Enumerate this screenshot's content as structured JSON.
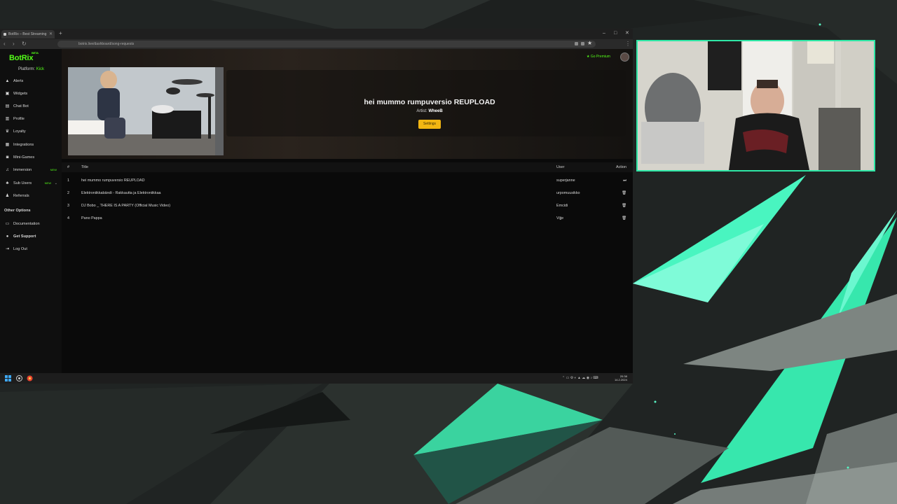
{
  "browser": {
    "tab_title": "BotRix – Best Streaming",
    "new_tab": "+",
    "url": "botrix.live/dashboard/song-requests",
    "minimize": "–",
    "maximize": "□",
    "close": "✕"
  },
  "app": {
    "logo": "BotRix",
    "logo_badge": "BETA",
    "platform_label": "Platform:",
    "platform_value": "Kick",
    "go_premium": "Go Premium"
  },
  "sidebar": {
    "items": [
      {
        "label": "Alerts",
        "icon": "alert-triangle-icon"
      },
      {
        "label": "Widgets",
        "icon": "widgets-icon"
      },
      {
        "label": "Chat Bot",
        "icon": "chat-icon"
      },
      {
        "label": "Profile",
        "icon": "profile-icon"
      },
      {
        "label": "Loyalty",
        "icon": "trophy-icon"
      },
      {
        "label": "Integrations",
        "icon": "grid-icon"
      },
      {
        "label": "Mini-Games",
        "icon": "gamepad-icon"
      },
      {
        "label": "Immersion",
        "icon": "music-icon",
        "badge": "NEW"
      },
      {
        "label": "Sub Users",
        "icon": "users-icon",
        "badge": "NEW"
      },
      {
        "label": "Referrals",
        "icon": "referrals-icon"
      }
    ],
    "other_options_heading": "Other Options",
    "other_items": [
      {
        "label": "Documentation",
        "icon": "doc-icon"
      },
      {
        "label": "Get Support",
        "icon": "support-icon"
      },
      {
        "label": "Log Out",
        "icon": "logout-icon"
      }
    ]
  },
  "now_playing": {
    "title": "hei mummo rumpuversio REUPLOAD",
    "artist_label": "Artist:",
    "artist": "WheeB",
    "settings_button": "Settings"
  },
  "queue": {
    "columns": {
      "num": "#",
      "title": "Title",
      "user": "User",
      "action": "Action"
    },
    "rows": [
      {
        "num": "1",
        "title": "hei mummo rumpuversio REUPLOAD",
        "user": "superjanne",
        "action": "skip-icon"
      },
      {
        "num": "2",
        "title": "Elektroniikkabändi - Rakkautta ja Elektroniikkaa",
        "user": "urpomuusikko",
        "action": "trash-icon"
      },
      {
        "num": "3",
        "title": "DJ Bobo _ THERE IS A PARTY (Official Music Video)",
        "user": "Emcidi",
        "action": "trash-icon"
      },
      {
        "num": "4",
        "title": "Pano Pappa",
        "user": "Vijje",
        "action": "trash-icon"
      }
    ]
  },
  "taskbar": {
    "time": "20:38",
    "date": "14.2.2024"
  },
  "colors": {
    "accent": "#53fc18",
    "button": "#f2b612",
    "webcam_border": "#2ee8a6"
  }
}
